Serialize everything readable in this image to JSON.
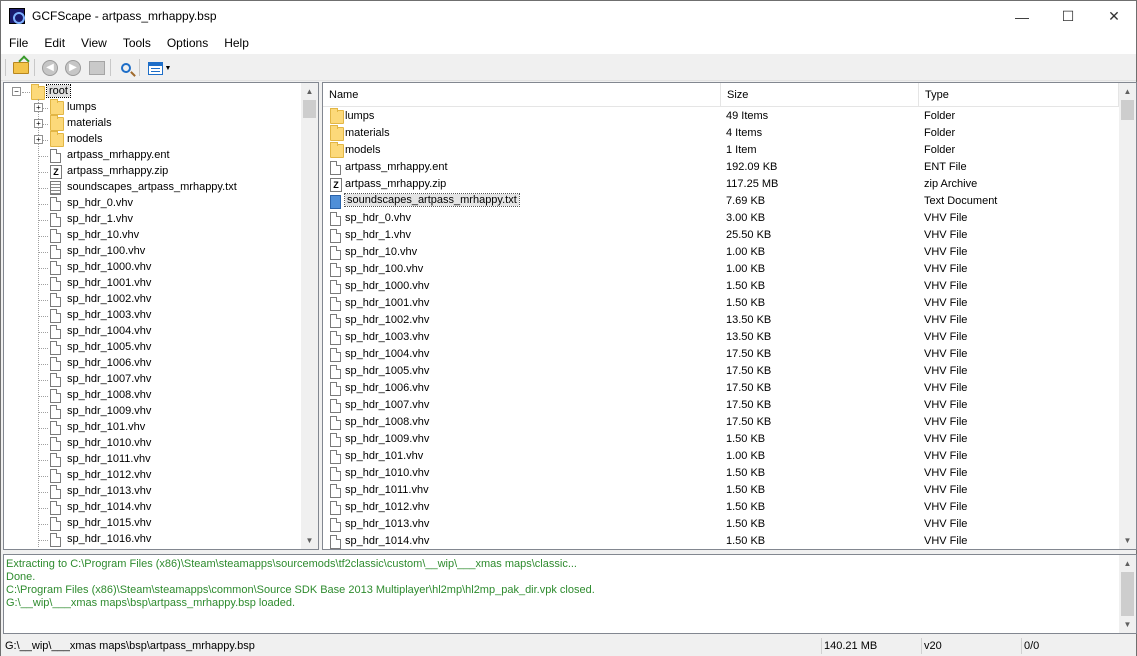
{
  "window": {
    "title": "GCFScape - artpass_mrhappy.bsp"
  },
  "menu": [
    "File",
    "Edit",
    "View",
    "Tools",
    "Options",
    "Help"
  ],
  "toolbar": {
    "open": "open-folder-icon",
    "back": "back-icon",
    "forward": "forward-icon",
    "up": "up-folder-icon",
    "find": "find-icon",
    "view": "view-mode-icon"
  },
  "tree": {
    "root": "root",
    "items": [
      {
        "label": "lumps",
        "icon": "folder-icon",
        "expandable": true
      },
      {
        "label": "materials",
        "icon": "folder-icon",
        "expandable": true
      },
      {
        "label": "models",
        "icon": "folder-icon",
        "expandable": true
      },
      {
        "label": "artpass_mrhappy.ent",
        "icon": "file-icon"
      },
      {
        "label": "artpass_mrhappy.zip",
        "icon": "zip-icon"
      },
      {
        "label": "soundscapes_artpass_mrhappy.txt",
        "icon": "text-file-icon"
      },
      {
        "label": "sp_hdr_0.vhv",
        "icon": "file-icon"
      },
      {
        "label": "sp_hdr_1.vhv",
        "icon": "file-icon"
      },
      {
        "label": "sp_hdr_10.vhv",
        "icon": "file-icon"
      },
      {
        "label": "sp_hdr_100.vhv",
        "icon": "file-icon"
      },
      {
        "label": "sp_hdr_1000.vhv",
        "icon": "file-icon"
      },
      {
        "label": "sp_hdr_1001.vhv",
        "icon": "file-icon"
      },
      {
        "label": "sp_hdr_1002.vhv",
        "icon": "file-icon"
      },
      {
        "label": "sp_hdr_1003.vhv",
        "icon": "file-icon"
      },
      {
        "label": "sp_hdr_1004.vhv",
        "icon": "file-icon"
      },
      {
        "label": "sp_hdr_1005.vhv",
        "icon": "file-icon"
      },
      {
        "label": "sp_hdr_1006.vhv",
        "icon": "file-icon"
      },
      {
        "label": "sp_hdr_1007.vhv",
        "icon": "file-icon"
      },
      {
        "label": "sp_hdr_1008.vhv",
        "icon": "file-icon"
      },
      {
        "label": "sp_hdr_1009.vhv",
        "icon": "file-icon"
      },
      {
        "label": "sp_hdr_101.vhv",
        "icon": "file-icon"
      },
      {
        "label": "sp_hdr_1010.vhv",
        "icon": "file-icon"
      },
      {
        "label": "sp_hdr_1011.vhv",
        "icon": "file-icon"
      },
      {
        "label": "sp_hdr_1012.vhv",
        "icon": "file-icon"
      },
      {
        "label": "sp_hdr_1013.vhv",
        "icon": "file-icon"
      },
      {
        "label": "sp_hdr_1014.vhv",
        "icon": "file-icon"
      },
      {
        "label": "sp_hdr_1015.vhv",
        "icon": "file-icon"
      },
      {
        "label": "sp_hdr_1016.vhv",
        "icon": "file-icon"
      }
    ]
  },
  "list": {
    "columns": [
      "Name",
      "Size",
      "Type"
    ],
    "rows": [
      {
        "name": "lumps",
        "size": "49 Items",
        "type": "Folder",
        "icon": "folder-icon"
      },
      {
        "name": "materials",
        "size": "4 Items",
        "type": "Folder",
        "icon": "folder-icon"
      },
      {
        "name": "models",
        "size": "1 Item",
        "type": "Folder",
        "icon": "folder-icon"
      },
      {
        "name": "artpass_mrhappy.ent",
        "size": "192.09 KB",
        "type": "ENT File",
        "icon": "file-icon"
      },
      {
        "name": "artpass_mrhappy.zip",
        "size": "117.25 MB",
        "type": "zip Archive",
        "icon": "zip-icon"
      },
      {
        "name": "soundscapes_artpass_mrhappy.txt",
        "size": "7.69 KB",
        "type": "Text Document",
        "icon": "text-file-icon",
        "selected": true
      },
      {
        "name": "sp_hdr_0.vhv",
        "size": "3.00 KB",
        "type": "VHV File",
        "icon": "file-icon"
      },
      {
        "name": "sp_hdr_1.vhv",
        "size": "25.50 KB",
        "type": "VHV File",
        "icon": "file-icon"
      },
      {
        "name": "sp_hdr_10.vhv",
        "size": "1.00 KB",
        "type": "VHV File",
        "icon": "file-icon"
      },
      {
        "name": "sp_hdr_100.vhv",
        "size": "1.00 KB",
        "type": "VHV File",
        "icon": "file-icon"
      },
      {
        "name": "sp_hdr_1000.vhv",
        "size": "1.50 KB",
        "type": "VHV File",
        "icon": "file-icon"
      },
      {
        "name": "sp_hdr_1001.vhv",
        "size": "1.50 KB",
        "type": "VHV File",
        "icon": "file-icon"
      },
      {
        "name": "sp_hdr_1002.vhv",
        "size": "13.50 KB",
        "type": "VHV File",
        "icon": "file-icon"
      },
      {
        "name": "sp_hdr_1003.vhv",
        "size": "13.50 KB",
        "type": "VHV File",
        "icon": "file-icon"
      },
      {
        "name": "sp_hdr_1004.vhv",
        "size": "17.50 KB",
        "type": "VHV File",
        "icon": "file-icon"
      },
      {
        "name": "sp_hdr_1005.vhv",
        "size": "17.50 KB",
        "type": "VHV File",
        "icon": "file-icon"
      },
      {
        "name": "sp_hdr_1006.vhv",
        "size": "17.50 KB",
        "type": "VHV File",
        "icon": "file-icon"
      },
      {
        "name": "sp_hdr_1007.vhv",
        "size": "17.50 KB",
        "type": "VHV File",
        "icon": "file-icon"
      },
      {
        "name": "sp_hdr_1008.vhv",
        "size": "17.50 KB",
        "type": "VHV File",
        "icon": "file-icon"
      },
      {
        "name": "sp_hdr_1009.vhv",
        "size": "1.50 KB",
        "type": "VHV File",
        "icon": "file-icon"
      },
      {
        "name": "sp_hdr_101.vhv",
        "size": "1.00 KB",
        "type": "VHV File",
        "icon": "file-icon"
      },
      {
        "name": "sp_hdr_1010.vhv",
        "size": "1.50 KB",
        "type": "VHV File",
        "icon": "file-icon"
      },
      {
        "name": "sp_hdr_1011.vhv",
        "size": "1.50 KB",
        "type": "VHV File",
        "icon": "file-icon"
      },
      {
        "name": "sp_hdr_1012.vhv",
        "size": "1.50 KB",
        "type": "VHV File",
        "icon": "file-icon"
      },
      {
        "name": "sp_hdr_1013.vhv",
        "size": "1.50 KB",
        "type": "VHV File",
        "icon": "file-icon"
      },
      {
        "name": "sp_hdr_1014.vhv",
        "size": "1.50 KB",
        "type": "VHV File",
        "icon": "file-icon"
      }
    ]
  },
  "log": [
    "Extracting to C:\\Program Files (x86)\\Steam\\steamapps\\sourcemods\\tf2classic\\custom\\__wip\\___xmas maps\\classic...",
    "Done.",
    "C:\\Program Files (x86)\\Steam\\steamapps\\common\\Source SDK Base 2013 Multiplayer\\hl2mp\\hl2mp_pak_dir.vpk closed.",
    "G:\\__wip\\___xmas maps\\bsp\\artpass_mrhappy.bsp loaded."
  ],
  "colors": {
    "log_text": "#2e8b2e"
  },
  "status": {
    "path": "G:\\__wip\\___xmas maps\\bsp\\artpass_mrhappy.bsp",
    "size": "140.21 MB",
    "version": "v20",
    "count": "0/0"
  }
}
